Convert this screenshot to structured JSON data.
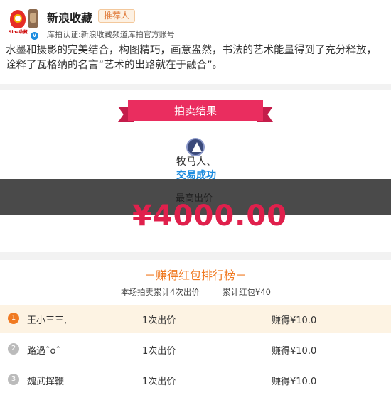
{
  "header": {
    "name": "新浪收藏",
    "tag": "推荐人",
    "cert": "库拍认证:新浪收藏频道库拍官方账号",
    "avatar_brand": "Sina收藏",
    "description": "水墨和摄影的完美结合，构图精巧，画意盎然，书法的艺术能量得到了充分释放，诠释了瓦格纳的名言“艺术的出路就在于融合”。"
  },
  "result": {
    "ribbon": "拍卖结果",
    "winner_name": "牧马人、",
    "status": "交易成功",
    "price_label": "最高出价",
    "price": "¥4000.00"
  },
  "ranking": {
    "title": "－赚得红包排行榜－",
    "total_bids": "本场拍卖累计4次出价",
    "total_red": "累计红包¥40",
    "rows": [
      {
        "rank": "1",
        "name": "王小三三,",
        "bids": "1次出价",
        "earn": "赚得¥10.0"
      },
      {
        "rank": "2",
        "name": "路過ˆoˆ",
        "bids": "1次出价",
        "earn": "赚得¥10.0"
      },
      {
        "rank": "3",
        "name": "魏武挥鞭",
        "bids": "1次出价",
        "earn": "赚得¥10.0"
      }
    ]
  },
  "colors": {
    "accent_red": "#ea2d5f",
    "price_red": "#e0204c",
    "link_blue": "#1e8de0",
    "orange": "#f07a22"
  }
}
